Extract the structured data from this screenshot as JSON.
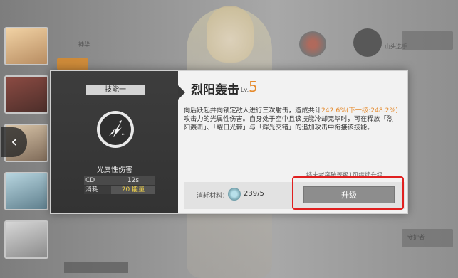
{
  "background": {
    "top_badge_label": "神华",
    "top_right_label": "山头选手",
    "side_labels": [
      "守护",
      "守护者"
    ],
    "bottom_tag": "选择"
  },
  "skill_panel": {
    "slot_label": "技能一",
    "element": "光属性伤害",
    "stats": [
      {
        "key": "CD",
        "value": "12s"
      },
      {
        "key": "消耗",
        "value": "20 能量"
      }
    ]
  },
  "skill": {
    "name": "烈阳轰击",
    "level_prefix": "Lv.",
    "level": "5",
    "desc_part1": "向后跃起并向锁定敌人进行三次射击，造成共计",
    "desc_highlight": "242.6%(下一级:248.2%)",
    "desc_part2": "攻击力的光属性伤害。自身处于空中且该技能冷却完毕时，可在释放「烈阳轰击」、「耀日光棘」与「辉光交错」的追加攻击中衔接该技能。",
    "upgrade_hint": "终末者突破等级1可继续升级"
  },
  "cost": {
    "label": "消耗材料：",
    "count": "239/5"
  },
  "actions": {
    "upgrade_label": "升级",
    "back_icon": "‹"
  },
  "colors": {
    "accent": "#e58a2c",
    "highlight_box": "#e02020",
    "energy": "#f5d64a"
  }
}
